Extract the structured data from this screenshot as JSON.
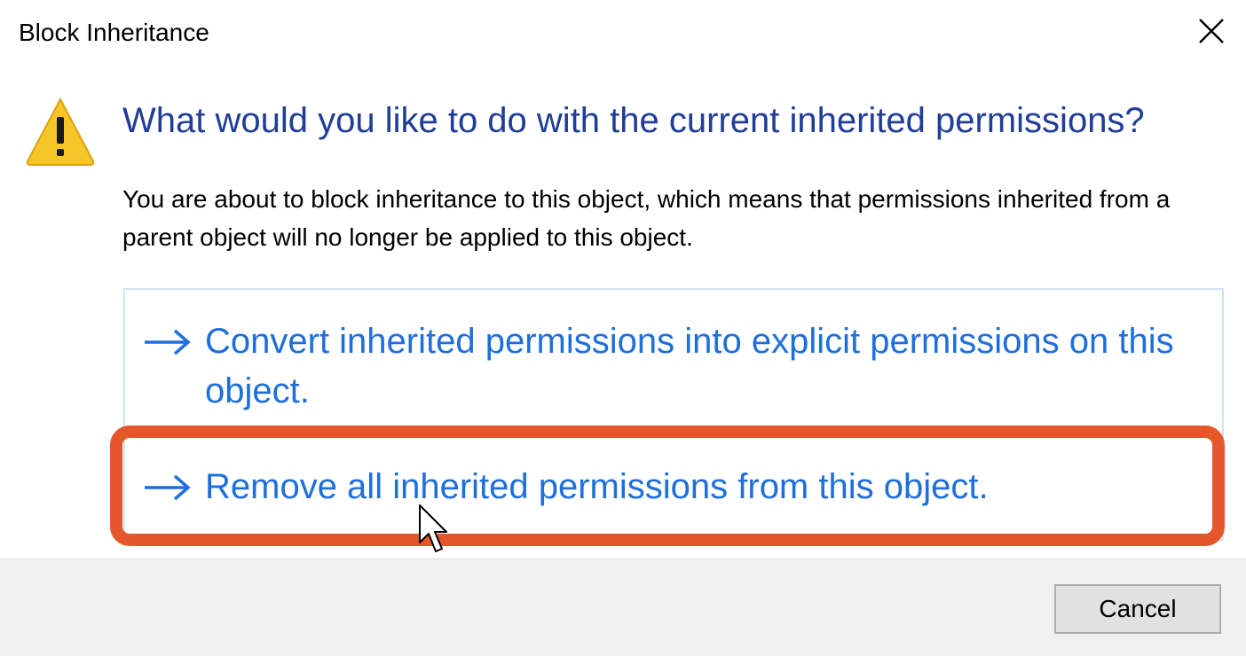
{
  "window": {
    "title": "Block Inheritance",
    "close_icon": "close-icon"
  },
  "main": {
    "warning_icon": "warning-icon",
    "heading": "What would you like to do with the current inherited permissions?",
    "description": "You are about to block inheritance to this object, which means that permissions inherited from a parent object will no longer be applied to this object."
  },
  "options": [
    {
      "icon": "arrow-right-icon",
      "label": "Convert inherited permissions into explicit permissions on this object."
    },
    {
      "icon": "arrow-right-icon",
      "label": "Remove all inherited permissions from this object."
    }
  ],
  "footer": {
    "cancel_label": "Cancel"
  },
  "colors": {
    "heading": "#1f3d99",
    "option_link": "#1e6fdc",
    "option_border": "#cfe3f7",
    "highlight": "#e5572b",
    "footer_bg": "#f0f0f0",
    "warning_fill": "#f7c42a"
  }
}
